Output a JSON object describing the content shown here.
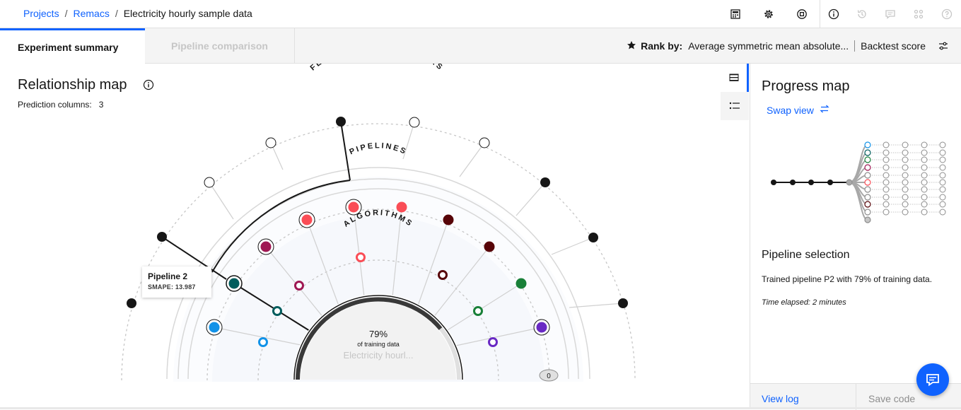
{
  "breadcrumb": {
    "projects": "Projects",
    "sep": "/",
    "project": "Remacs",
    "current": "Electricity hourly sample data"
  },
  "header_icons": [
    "calculator-icon",
    "gear-icon",
    "stop-icon",
    "info-icon",
    "history-icon",
    "chat-icon",
    "apps-icon",
    "help-icon"
  ],
  "tabs": {
    "summary": "Experiment summary",
    "comparison": "Pipeline comparison"
  },
  "rank": {
    "label": "Rank by:",
    "metric": "Average symmetric mean absolute...",
    "score": "Backtest score"
  },
  "relationship_map": {
    "title": "Relationship map",
    "pred_label": "Prediction columns:",
    "pred_value": "3",
    "ring_feature": "FEATURE TRANSFORMERS",
    "ring_pipelines": "PIPELINES",
    "ring_algorithms": "ALGORITHMS",
    "center_percent": "79%",
    "center_caption": "of training data",
    "center_dataset": "Electricity hourl...",
    "zero_badge": "0",
    "tooltip_title": "Pipeline 2",
    "tooltip_metric": "SMAPE: 13.987"
  },
  "colors": {
    "accent": "#0f62fe",
    "pipeline_red": "#fa4d56",
    "pipeline_magenta": "#9f1853",
    "pipeline_dark_red": "#570408",
    "pipeline_teal": "#005d5d",
    "pipeline_green": "#198038",
    "pipeline_blue": "#1192e8",
    "pipeline_purple": "#6929c4"
  },
  "progress_map": {
    "title": "Progress map",
    "swap": "Swap view",
    "selection_title": "Pipeline selection",
    "selection_desc": "Trained pipeline P2 with 79% of training data.",
    "time": "Time elapsed: 2 minutes",
    "view_log": "View log",
    "save_code": "Save code"
  }
}
